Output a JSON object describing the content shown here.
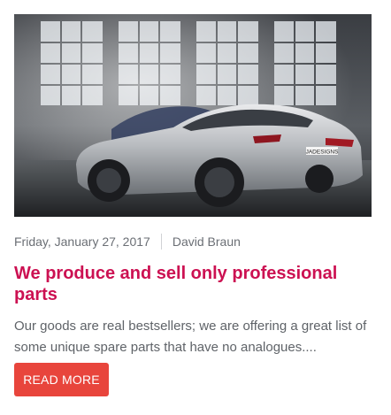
{
  "post": {
    "date": "Friday, January 27, 2017",
    "author": "David Braun",
    "title": "We produce and sell only professional parts",
    "excerpt": "Our goods are real bestsellers; we are offering a great list of some unique spare parts that have no analogues....",
    "read_more_label": "Read more",
    "license_plate": "JADESIGNS",
    "image_subject": "silver-coupe-in-garage"
  },
  "colors": {
    "title": "#cc1152",
    "button": "#e8453c",
    "meta_text": "#6b6f75",
    "body_text": "#5f6368"
  }
}
